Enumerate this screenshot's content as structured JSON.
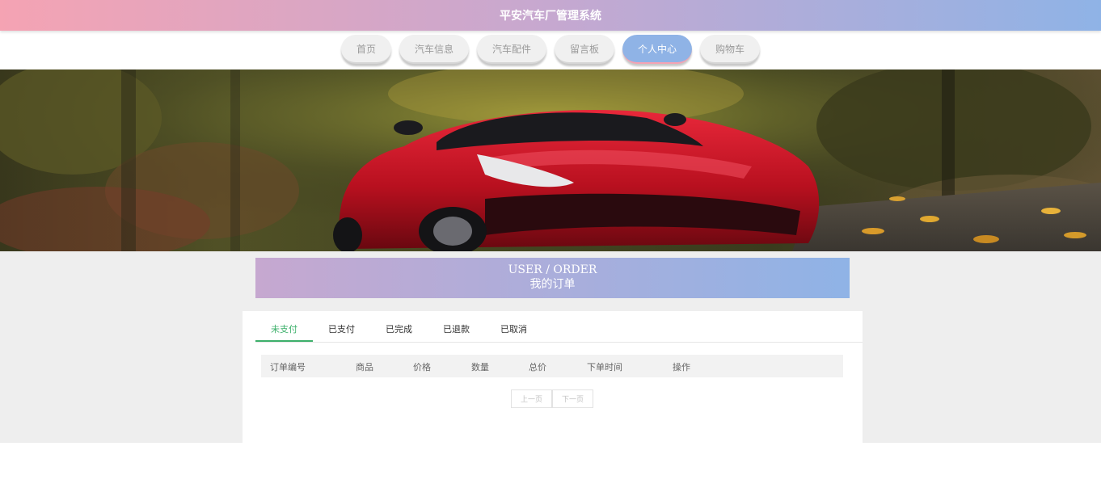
{
  "header": {
    "title": "平安汽车厂管理系统"
  },
  "nav": {
    "items": [
      {
        "label": "首页"
      },
      {
        "label": "汽车信息"
      },
      {
        "label": "汽车配件"
      },
      {
        "label": "留言板"
      },
      {
        "label": "个人中心"
      },
      {
        "label": "购物车"
      }
    ],
    "active": "个人中心"
  },
  "section": {
    "title_en": "USER / ORDER",
    "title_cn": "我的订单"
  },
  "tabs": {
    "items": [
      {
        "label": "未支付"
      },
      {
        "label": "已支付"
      },
      {
        "label": "已完成"
      },
      {
        "label": "已退款"
      },
      {
        "label": "已取消"
      }
    ],
    "active": "未支付"
  },
  "table": {
    "columns": [
      "订单编号",
      "商品",
      "价格",
      "数量",
      "总价",
      "下单时间",
      "操作"
    ],
    "rows": []
  },
  "pagination": {
    "prev_label": "上一页",
    "next_label": "下一页"
  },
  "colors": {
    "accent_pink": "#f5a3b3",
    "accent_blue": "#8fb3e6",
    "tab_active": "#3db06b"
  }
}
